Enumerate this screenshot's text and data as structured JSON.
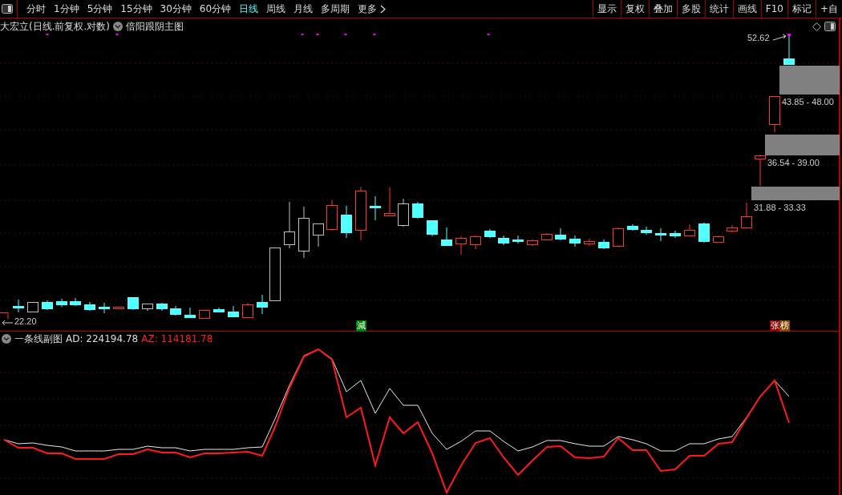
{
  "toolbar": {
    "periods": [
      {
        "label": "分时",
        "selected": false
      },
      {
        "label": "1分钟",
        "selected": false
      },
      {
        "label": "5分钟",
        "selected": false
      },
      {
        "label": "15分钟",
        "selected": false
      },
      {
        "label": "30分钟",
        "selected": false
      },
      {
        "label": "60分钟",
        "selected": false
      },
      {
        "label": "日线",
        "selected": true
      },
      {
        "label": "周线",
        "selected": false
      },
      {
        "label": "月线",
        "selected": false
      },
      {
        "label": "多周期",
        "selected": false
      }
    ],
    "more": "更多",
    "buttons": [
      "显示",
      "复权",
      "叠加",
      "多股",
      "统计",
      "画线",
      "F10",
      "标记",
      "+自"
    ]
  },
  "main_chart": {
    "title": "大宏立(日线.前复权.对数)",
    "indicator": "倍阳跟阴主图",
    "price_labels": [
      {
        "text": "52.62",
        "kind": "arrow"
      },
      {
        "text": "43.85 - 48.00",
        "kind": "range"
      },
      {
        "text": "36.54 - 39.00",
        "kind": "range"
      },
      {
        "text": "31.88 - 33.33",
        "kind": "range"
      },
      {
        "text": "22.20",
        "kind": "low"
      }
    ],
    "markers": [
      {
        "text": "減",
        "color": "#007a00"
      },
      {
        "text": "张",
        "color": "#8b0000"
      },
      {
        "text": "榜",
        "color": "#8b4500"
      }
    ]
  },
  "sub_chart": {
    "title": "一条线副图",
    "ad": "AD: 224194.78",
    "az": "AZ: 114181.78"
  }
}
